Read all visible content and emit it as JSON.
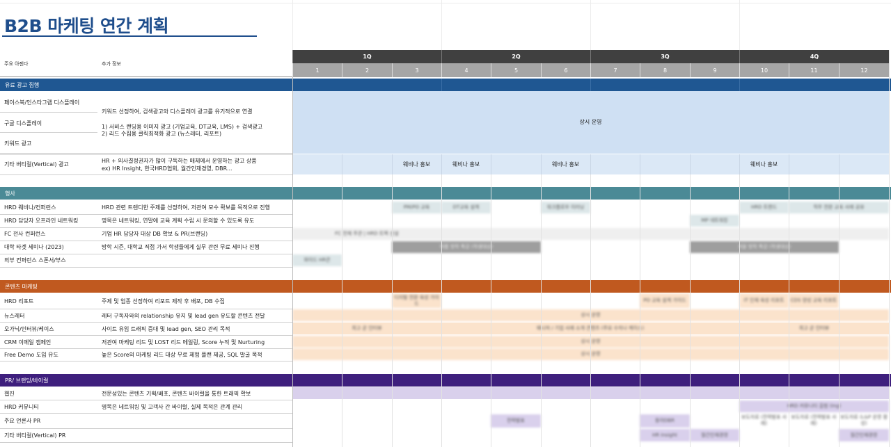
{
  "title": "B2B 마케팅 연간 계획",
  "header": {
    "agenda_label": "주요 아젠다",
    "info_label": "추가 정보",
    "quarters": [
      "1Q",
      "2Q",
      "3Q",
      "4Q"
    ],
    "months": [
      "1",
      "2",
      "3",
      "4",
      "5",
      "6",
      "7",
      "8",
      "9",
      "10",
      "11",
      "12"
    ]
  },
  "colors": {
    "paid": "#1f5792",
    "event": "#4b8a96",
    "content": "#c0591f",
    "pr": "#3e1f7d",
    "paid_fill": "#cfe0f3",
    "content_fill": "#fbe3cc",
    "pr_fill": "#d9d0ec",
    "pr_band": "#3e1f7d"
  },
  "sections": {
    "paid": {
      "title": "유료 광고 집행",
      "rows": [
        {
          "label": "페이스북/인스타그램 디스플레이"
        },
        {
          "label": "구글 디스플레이"
        },
        {
          "label": "키워드 광고"
        },
        {
          "label": "기타 버티컬(Vertical) 광고"
        }
      ],
      "info_main": "키워드 선정하여, 검색광고와 디스플레이 광고를 유기적으로 연결",
      "info_line1": "1) 서비스 랜딩용 이미지 광고 (기업교육, DT교육, LMS) + 검색광고",
      "info_line2": "2) 리드 수집용 클릭최적화 광고 (뉴스레터, 리포트)",
      "vertical_info1": "HR + 의사결정권자가 많이 구독하는 매체에서 운영하는 광고 상품",
      "vertical_info2": "ex) HR Insight, 한국HRD협회, 월간인재경영, DBR...",
      "always_on": "상시 운영",
      "webinar": "웨비나 홍보"
    },
    "event": {
      "title": "행사",
      "rows": [
        {
          "label": "HRD 웨비나/컨퍼런스",
          "info": "HRD 관련 트렌디한 주제를 선정하여, 저관여 모수 확보를 목적으로 진행"
        },
        {
          "label": "HRD 담당자 오프라인 네트워킹",
          "info": "명목은 네트워킹, 연말에 교육 계획 수립 시 문의할 수 있도록 유도"
        },
        {
          "label": "FC 전사 컨퍼런스",
          "info": "기업 HR 담당자 대상 DB 확보 & PR(브랜딩)"
        },
        {
          "label": "대학 타겟 세미나 (2023)",
          "info": "방학 시즌, 대학교 직접 가서 학생들에게 실무 관련 무료 세미나 진행"
        },
        {
          "label": "외부 컨퍼런스 스폰서/부스",
          "info": ""
        }
      ],
      "blurred": [
        "PM/PO 교육",
        "DT교육 설계",
        "워크플로우 이러닝",
        "HRD 트렌드",
        "직무 전환 교육 사례 공유",
        "MP 네트워킹",
        "FC 전체 주관 | HRD 트랙 신설",
        "여름 방학 특강 (학생대상)",
        "겨울 방학 특강 (학생대상)",
        "와이드 HR콘"
      ]
    },
    "content": {
      "title": "콘텐츠 마케팅",
      "rows": [
        {
          "label": "HRD 리포트",
          "info": "주제 및 업종 선정하여 리포트 제작 후 배포, DB 수집"
        },
        {
          "label": "뉴스레터",
          "info": "레터 구독자와의 relationship 유지 및 lead gen 유도할 콘텐츠 전달"
        },
        {
          "label": "오가닉/인터뷰/케이스",
          "info": "사이트 유입 트래픽 증대 및 lead gen, SEO 관리 목적"
        },
        {
          "label": "CRM 이메일 캠페인",
          "info": "저관여 마케팅 리드 및 LOST 리드 메일링, Score 누적 및 Nurturing"
        },
        {
          "label": "Free Demo 도입 유도",
          "info": "높은 Score의 마케팅 리드 대상 무료 체험 플랜 제공, SQL 발굴 목적"
        }
      ],
      "blurred": [
        "디지털 전환 육성 가이드",
        "PO 교육 설계 가이드",
        "IT 인재 육성 리포트",
        "CDS 양성 교육 리포트",
        "상시 운영",
        "최고 곧 인터뷰",
        "웨나처 / 기업 사례 소개 콘텐츠 (주요 수치나 케이스)",
        "최고 곧 인터뷰",
        "상시 운영",
        "상시 운영"
      ]
    },
    "pr": {
      "title": "PR/ 브랜딩/바이럴",
      "rows": [
        {
          "label": "웹진",
          "info": "전문성있는 콘텐츠 기획/배포, 콘텐츠 바이럴을 통한 트래픽 확보"
        },
        {
          "label": "HRD 커뮤니티",
          "info": "명목은 네트워킹 및 고객사 간 바이럴, 실제 목적은 관계 관리"
        },
        {
          "label": "주요 언론사 PR",
          "info": ""
        },
        {
          "label": "기타 버티컬(Vertical) PR",
          "info": ""
        }
      ],
      "blurred": [
        "HRD 커뮤니티 출범 (Ing)",
        "전략발표",
        "동아DBR",
        "보도자료 (전략발표 사례)",
        "보도자료 (전략발표 사례)",
        "보도자료 (L&P 운영 활성)",
        "HR Insight",
        "월간인재경영",
        "월간인재경영"
      ]
    }
  }
}
